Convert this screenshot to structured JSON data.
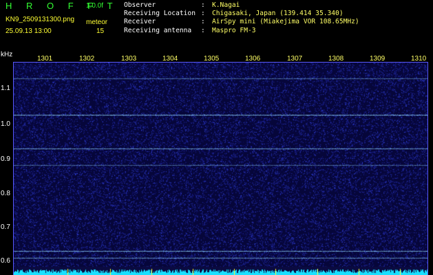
{
  "app": {
    "title": "H R O F F T",
    "version": "1.0.0f"
  },
  "file": {
    "name": "KN9_2509131300.png",
    "datetime": "25.09.13 13:00"
  },
  "meteor": {
    "label": "meteor",
    "count": "15"
  },
  "info": [
    {
      "key": "Observer",
      "value": "K.Nagai"
    },
    {
      "key": "Receiving Location",
      "value": "Chigasaki, Japan (139.414 35.340)"
    },
    {
      "key": "Receiver",
      "value": "AirSpy mini (Miakejima VOR 108.65MHz)"
    },
    {
      "key": "Receiving antenna",
      "value": "Maspro FM-3"
    }
  ],
  "axis": {
    "unit": "kHz",
    "freq_labels": [
      "1.1",
      "1.0",
      "0.9",
      "0.8",
      "0.7",
      "0.6"
    ],
    "freq_values": [
      1.1,
      1.0,
      0.9,
      0.8,
      0.7,
      0.6
    ],
    "time_labels": [
      "1301",
      "1302",
      "1303",
      "1304",
      "1305",
      "1306",
      "1307",
      "1308",
      "1309",
      "1310"
    ],
    "freq_range": [
      0.575,
      1.16
    ]
  },
  "traces": [
    {
      "freq": 1.115,
      "strength": 0.55
    },
    {
      "freq": 1.01,
      "strength": 0.95
    },
    {
      "freq": 0.913,
      "strength": 0.8
    },
    {
      "freq": 0.867,
      "strength": 0.55
    },
    {
      "freq": 0.62,
      "strength": 0.9
    },
    {
      "freq": 0.6,
      "strength": 0.75
    }
  ],
  "colors": {
    "background": "#000000",
    "title": "#33ff33",
    "file": "#ffff33",
    "label": "#ffffff",
    "value": "#ffff66",
    "noise": "#1a1aa0",
    "trace": "#8fe4ff",
    "baseline": "#19e0ff"
  }
}
